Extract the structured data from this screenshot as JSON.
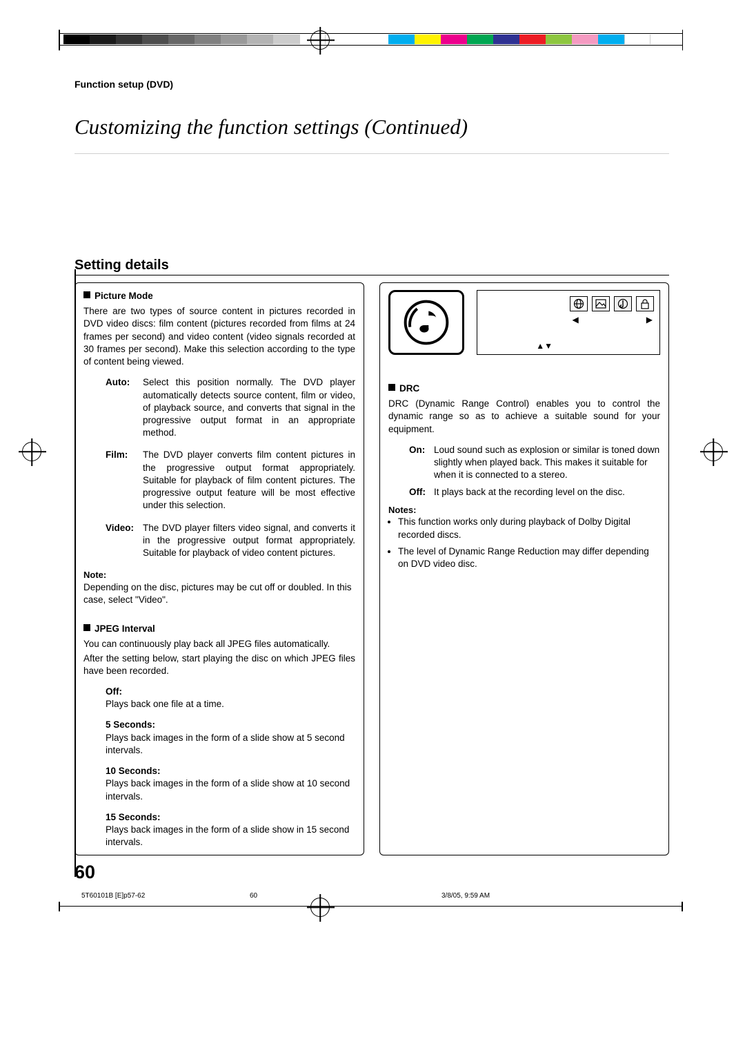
{
  "header": {
    "section": "Function setup (DVD)"
  },
  "title": "Customizing the function settings (Continued)",
  "setting_heading": "Setting details",
  "left": {
    "picture_mode": {
      "title": "Picture Mode",
      "intro": "There are two types of source content in pictures recorded in DVD video discs: film content (pictures recorded from films at 24 frames per second) and video content (video signals recorded at 30 frames per second). Make this selection according to the type of content being viewed.",
      "auto_label": "Auto:",
      "auto_text": "Select this position normally. The DVD player automatically detects source content, film or video, of playback source, and converts that signal in the progressive output format in an appropriate method.",
      "film_label": "Film:",
      "film_text": "The DVD player converts film content pictures in the progressive output format appropriately. Suitable for playback of film content pictures. The progressive output feature will be most effective under this selection.",
      "video_label": "Video:",
      "video_text": "The DVD player filters video signal, and converts it in the progressive output format appropriately. Suitable for playback of video content pictures.",
      "note_label": "Note:",
      "note_text": "Depending on the disc, pictures may be cut off or doubled. In this case, select \"Video\"."
    },
    "jpeg": {
      "title": "JPEG Interval",
      "intro1": "You can continuously play back all JPEG files automatically.",
      "intro2": "After the setting below, start playing the disc on which JPEG files have been recorded.",
      "opts": [
        {
          "label": "Off:",
          "text": "Plays back one file at a time."
        },
        {
          "label": "5 Seconds:",
          "text": "Plays back images in the form of a slide show at 5 second intervals."
        },
        {
          "label": "10 Seconds:",
          "text": "Plays back images in the form of a slide show at 10 second intervals."
        },
        {
          "label": "15 Seconds:",
          "text": "Plays back images in the form of a slide show in 15 second intervals."
        }
      ]
    }
  },
  "right": {
    "drc": {
      "title": "DRC",
      "intro": "DRC (Dynamic Range Control) enables you to control the dynamic range so as to achieve a suitable sound for your equipment.",
      "on_label": "On:",
      "on_text": "Loud sound such as explosion or similar is toned down slightly when played back. This makes it suitable for when it is connected to a stereo.",
      "off_label": "Off:",
      "off_text": "It plays back at the recording level on the disc.",
      "notes_label": "Notes:",
      "notes": [
        "This function works only during playback of Dolby Digital recorded discs.",
        "The level of Dynamic Range Reduction may differ depending on DVD video disc."
      ]
    },
    "osd": {
      "arrows_ud": "▲▼"
    }
  },
  "page_number": "60",
  "footer": {
    "file": "5T60101B [E]p57-62",
    "page": "60",
    "date": "3/8/05, 9:59 AM"
  }
}
